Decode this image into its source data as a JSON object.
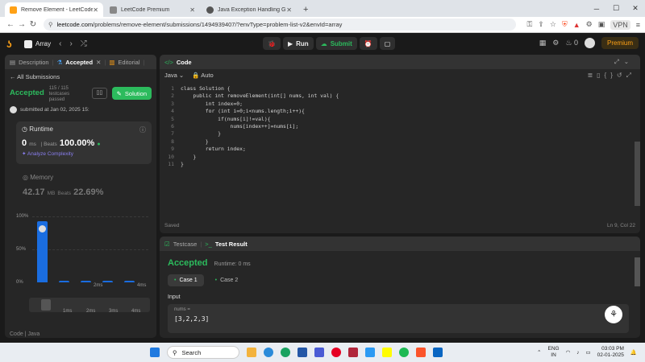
{
  "browser": {
    "tabs": [
      {
        "title": "Remove Element - LeetCode",
        "color": "#ffa116",
        "active": true
      },
      {
        "title": "LeetCode Premium",
        "color": "#888888",
        "active": false
      },
      {
        "title": "Java Exception Handling Guide",
        "color": "#555555",
        "active": false
      }
    ],
    "url_domain": "leetcode.com",
    "url_path": "/problems/remove-element/submissions/1494939407/?envType=problem-list-v2&envId=array",
    "vpn_label": "VPN"
  },
  "header": {
    "problem_list": "Array",
    "run_label": "Run",
    "submit_label": "Submit",
    "points": "0",
    "premium_label": "Premium"
  },
  "left": {
    "tabs": [
      "Description",
      "Accepted",
      "Editorial"
    ],
    "all_submissions": "All Submissions",
    "accepted": "Accepted",
    "testcases": "115 / 115 testcases passed",
    "solution_label": "Solution",
    "submitted": "submitted at Jan 02, 2025 15:",
    "runtime_label": "Runtime",
    "runtime_value": "0",
    "runtime_unit": "ms",
    "runtime_beats_label": "Beats",
    "runtime_beats": "100.00%",
    "analyze": "Analyze Complexity",
    "memory_label": "Memory",
    "memory_value": "42.17",
    "memory_unit": "MB",
    "memory_beats_label": "Beats",
    "memory_beats": "22.69%",
    "bottom_tabs": [
      "Code",
      "Java"
    ]
  },
  "chart_data": {
    "type": "bar",
    "y_ticks": [
      "100%",
      "50%",
      "0%"
    ],
    "ylim": [
      0,
      100
    ],
    "x_labels": [
      "2ms",
      "4ms"
    ],
    "values": [
      93,
      2,
      2,
      2,
      2
    ],
    "brush_labels": [
      "1ms",
      "2ms",
      "3ms",
      "4ms"
    ]
  },
  "code": {
    "title": "Code",
    "language": "Java",
    "mode": "Auto",
    "lines": [
      "class Solution {",
      "    public int removeElement(int[] nums, int val) {",
      "        int index=0;",
      "        for (int i=0;i<nums.length;i++){",
      "            if(nums[i]!=val){",
      "                nums[index++]=nums[i];",
      "            }",
      "        }",
      "        return index;",
      "    }",
      "}"
    ],
    "saved": "Saved",
    "position": "Ln 9, Col 22"
  },
  "result": {
    "tab_testcase": "Testcase",
    "tab_result": "Test Result",
    "status": "Accepted",
    "runtime": "Runtime: 0 ms",
    "cases": [
      "Case 1",
      "Case 2"
    ],
    "input_label": "Input",
    "param_name": "nums =",
    "param_value": "[3,2,2,3]"
  },
  "taskbar": {
    "search": "Search",
    "lang": "ENG",
    "region": "IN",
    "time": "03:03 PM",
    "date": "02-01-2025"
  }
}
